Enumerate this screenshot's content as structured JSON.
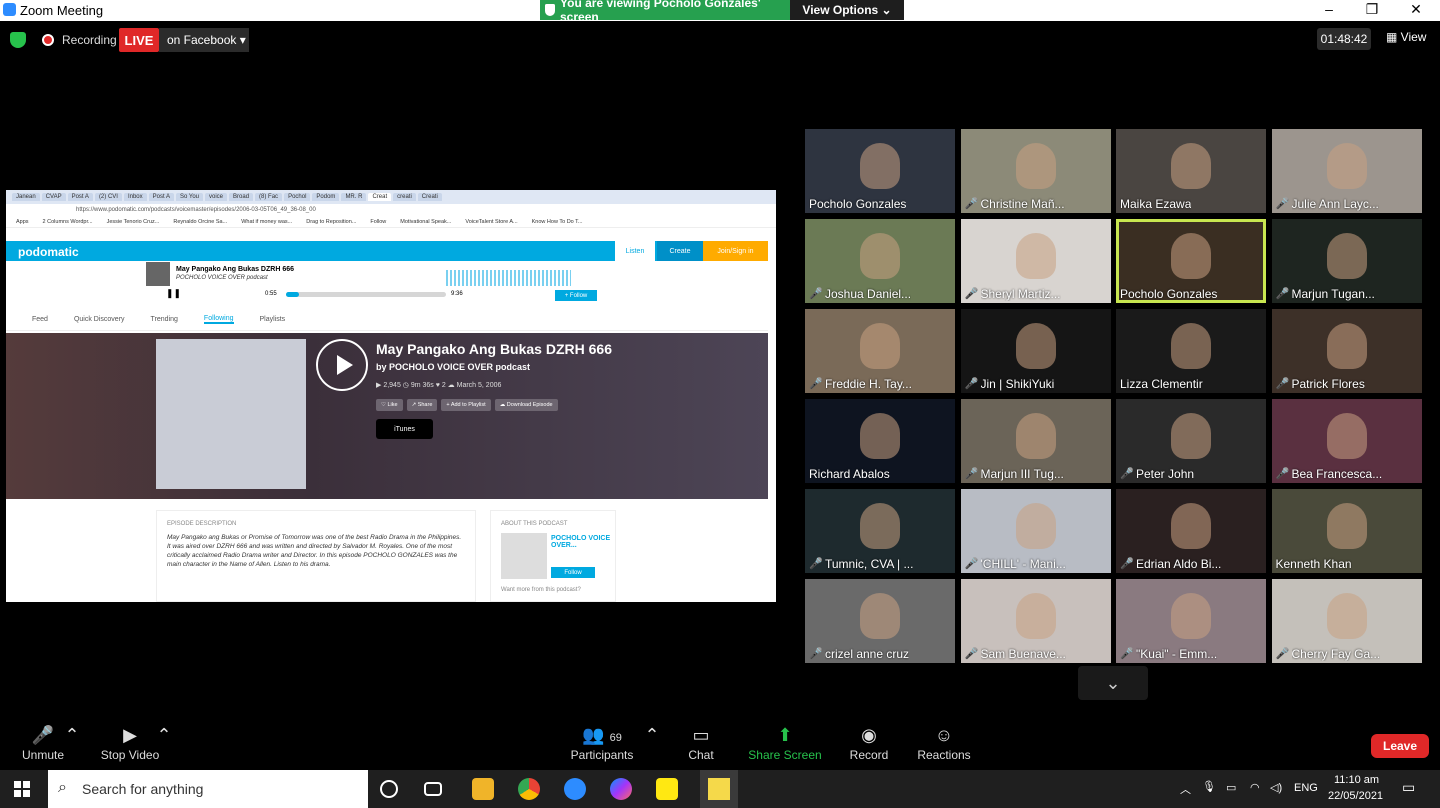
{
  "window": {
    "title": "Zoom Meeting",
    "minimize": "–",
    "restore": "❐",
    "close": "✕"
  },
  "banner": {
    "viewing": "You are viewing Pocholo Gonzales' screen",
    "view_options": "View Options ⌄"
  },
  "status": {
    "recording": "Recording",
    "live": "LIVE",
    "on_facebook": "on Facebook ▾",
    "timer": "01:48:42",
    "view": "View"
  },
  "shared": {
    "tabs": [
      "Janean",
      "CVAP",
      "Post A",
      "(2) CVI",
      "Inbox",
      "Post A",
      "So You",
      "voice",
      "Broad",
      "(8) Fac",
      "Pochol",
      "Podom",
      "MR. R",
      "Creat",
      "creati",
      "Creati"
    ],
    "url": "https://www.podomatic.com/podcasts/voicemaster/episodes/2006-03-05T06_49_36-08_00",
    "bookmarks": [
      "Apps",
      "2 Columns Wordpr...",
      "Jessie Tenorio Cruz...",
      "Reynaldo Orcine Sa...",
      "What if money was...",
      "Drag to Reposition...",
      "Follow",
      "Motivational Speak...",
      "VoiceTalent Store A...",
      "Know How To Do T..."
    ],
    "logo": "podomatic",
    "listen": "Listen",
    "create": "Create",
    "join": "Join/Sign in",
    "player_title": "May Pangako Ang Bukas DZRH 666",
    "player_sub": "POCHOLO VOICE OVER podcast",
    "time_cur": "0:55",
    "time_dur": "9:36",
    "follow": "+ Follow",
    "nav": [
      "Feed",
      "Quick Discovery",
      "Trending",
      "Following",
      "Playlists"
    ],
    "ep_title": "May Pangako Ang Bukas DZRH 666",
    "ep_by": "by POCHOLO VOICE OVER podcast",
    "ep_meta": "▶ 2,945   ◷ 9m 36s   ♥ 2   ☁ March 5, 2006",
    "actions": [
      "♡ Like",
      "↗ Share",
      "+ Add to Playlist",
      "☁ Download Episode"
    ],
    "itunes": "iTunes",
    "desc_head": "EPISODE DESCRIPTION",
    "desc": "May Pangako ang Bukas or Promise of Tomorrow was one of the best Radio Drama in the Philippines. It was aired over DZRH 666 and was written and directed by Salvador M. Royales. One of the most critically acclaimed Radio Drama writer and Director. In this episode POCHOLO GONZALES was the main character in the Name of Allen. Listen to his drama.",
    "about_head": "ABOUT THIS PODCAST",
    "about_name": "POCHOLO VOICE OVER...",
    "about_follow": "Follow",
    "about_more": "Want more from this podcast?"
  },
  "participants": [
    {
      "name": "Pocholo Gonzales",
      "muted": false,
      "color": "#2e3440"
    },
    {
      "name": "Christine Mañ...",
      "muted": true,
      "color": "#8c8a78"
    },
    {
      "name": "Maika Ezawa",
      "muted": false,
      "color": "#4a4541"
    },
    {
      "name": "Julie Ann Layc...",
      "muted": true,
      "color": "#9c958e"
    },
    {
      "name": "Joshua Daniel...",
      "muted": true,
      "color": "#6b7a55"
    },
    {
      "name": "Sheryl Martiz...",
      "muted": true,
      "color": "#d8d4d0"
    },
    {
      "name": "Pocholo Gonzales",
      "muted": false,
      "color": "#3a2e22",
      "active": true
    },
    {
      "name": "Marjun Tugan...",
      "muted": true,
      "color": "#1e2520"
    },
    {
      "name": "Freddie H. Tay...",
      "muted": true,
      "color": "#7a6a58"
    },
    {
      "name": "Jin | ShikiYuki",
      "muted": true,
      "color": "#151515"
    },
    {
      "name": "Lizza Clementir",
      "muted": false,
      "color": "#1a1a1a"
    },
    {
      "name": "Patrick Flores",
      "muted": true,
      "color": "#3d3028"
    },
    {
      "name": "Richard Abalos",
      "muted": false,
      "color": "#0e1420"
    },
    {
      "name": "Marjun III Tug...",
      "muted": true,
      "color": "#6b6458"
    },
    {
      "name": "Peter John",
      "muted": true,
      "color": "#2a2a2a"
    },
    {
      "name": "Bea Francesca...",
      "muted": true,
      "color": "#5a3040"
    },
    {
      "name": "Tumnic, CVA | ...",
      "muted": true,
      "color": "#1e2a2e"
    },
    {
      "name": "'CHILL' - Mani...",
      "muted": true,
      "color": "#b8bcc4"
    },
    {
      "name": "Edrian Aldo Bi...",
      "muted": true,
      "color": "#2a2020"
    },
    {
      "name": "Kenneth Khan",
      "muted": false,
      "color": "#4a4a3a"
    },
    {
      "name": "crizel anne cruz",
      "muted": true,
      "color": "#6a6a6a"
    },
    {
      "name": "Sam Buenave...",
      "muted": true,
      "color": "#c8c0bc"
    },
    {
      "name": "\"Kuai\" - Emm...",
      "muted": true,
      "color": "#8a7a80"
    },
    {
      "name": "Cherry Fay Ga...",
      "muted": true,
      "color": "#c4c0ba"
    }
  ],
  "toolbar": {
    "unmute": "Unmute",
    "stop_video": "Stop Video",
    "participants": "Participants",
    "participants_count": "69",
    "chat": "Chat",
    "share": "Share Screen",
    "record": "Record",
    "reactions": "Reactions",
    "leave": "Leave"
  },
  "taskbar": {
    "search": "Search for anything",
    "lang": "ENG",
    "time": "11:10 am",
    "date": "22/05/2021"
  }
}
